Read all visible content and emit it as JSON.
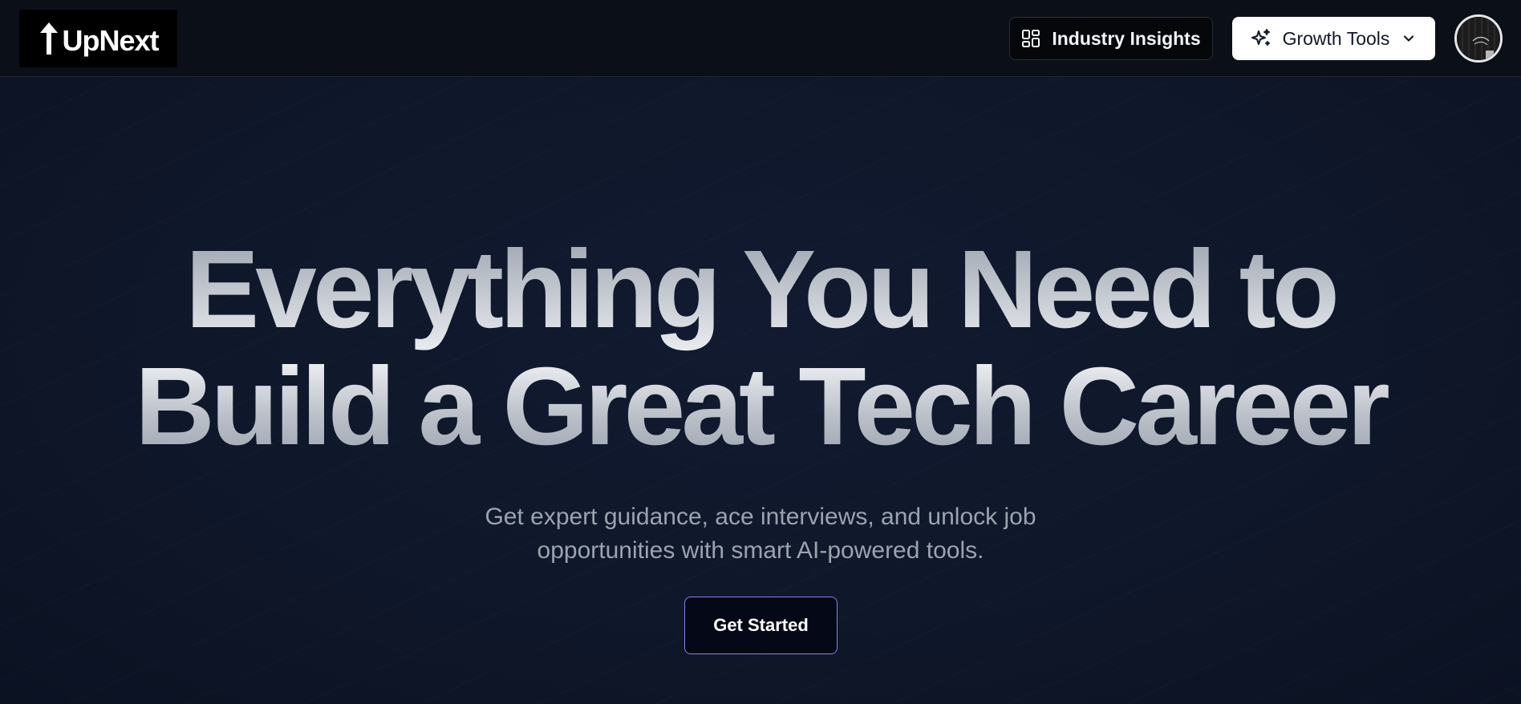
{
  "header": {
    "logo_text": "UpNext",
    "nav": {
      "insights": {
        "label": "Industry Insights",
        "icon": "layout-dashboard-icon"
      },
      "growth": {
        "label": "Growth Tools",
        "icon": "sparkles-icon",
        "caret_icon": "chevron-down-icon"
      }
    },
    "avatar": {
      "icon": "user-avatar"
    }
  },
  "hero": {
    "title_line1": "Everything You Need to",
    "title_line2": "Build a Great Tech Career",
    "subtitle_line1": "Get expert guidance, ace interviews, and unlock job",
    "subtitle_line2": "opportunities with smart AI-powered tools.",
    "cta_label": "Get Started"
  },
  "colors": {
    "background": "#0f172a",
    "header_bg": "#0b0f17",
    "cta_border": "#8b7fe6",
    "subtitle": "#9ca3af"
  }
}
